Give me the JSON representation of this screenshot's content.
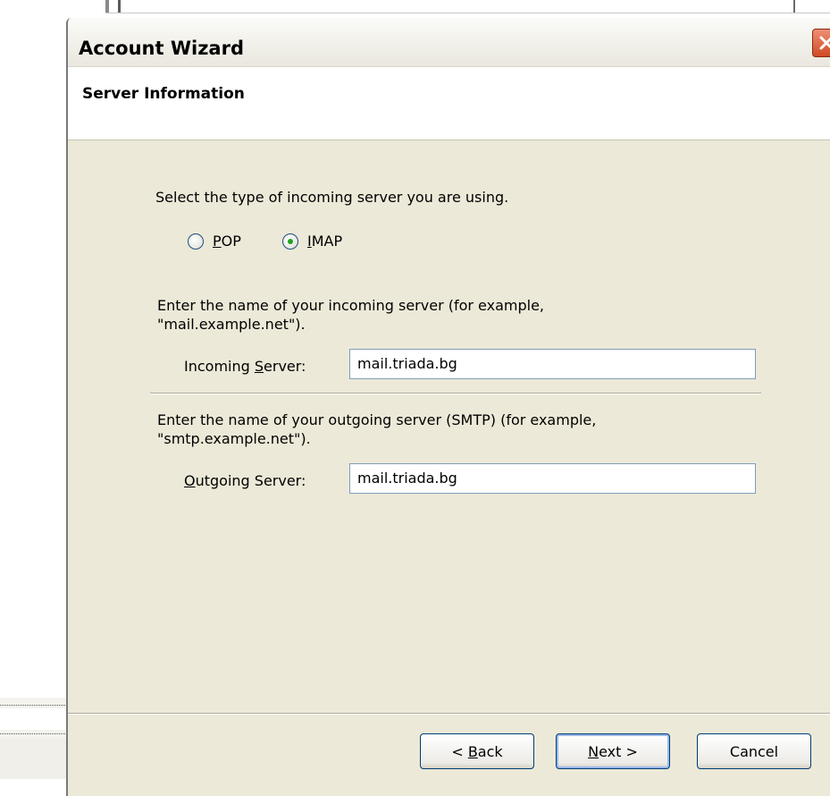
{
  "background": {
    "top_glyphs": "· · · · · ( · · · ) · · · · ·"
  },
  "dialog": {
    "title": "Account Wizard",
    "close_icon": "close-icon"
  },
  "header": {
    "title": "Server Information"
  },
  "server_type": {
    "prompt": "Select the type of incoming server you are using.",
    "options": [
      {
        "label": "POP",
        "accesskey": "P",
        "rest": "OP",
        "selected": false
      },
      {
        "label": "IMAP",
        "accesskey": "I",
        "rest": "MAP",
        "selected": true
      }
    ]
  },
  "incoming": {
    "description_line1": "Enter the name of your incoming server (for example,",
    "description_line2": "\"mail.example.net\").",
    "label_prefix": "Incoming ",
    "label_accesskey": "S",
    "label_suffix": "erver:",
    "value": "mail.triada.bg"
  },
  "outgoing": {
    "description_line1": "Enter the name of your outgoing server (SMTP) (for example,",
    "description_line2": "\"smtp.example.net\").",
    "label_accesskey": "O",
    "label_suffix": "utgoing Server:",
    "value": "mail.triada.bg"
  },
  "buttons": {
    "back_prefix": "< ",
    "back_accesskey": "B",
    "back_suffix": "ack",
    "next_accesskey": "N",
    "next_suffix": "ext >",
    "cancel": "Cancel"
  }
}
